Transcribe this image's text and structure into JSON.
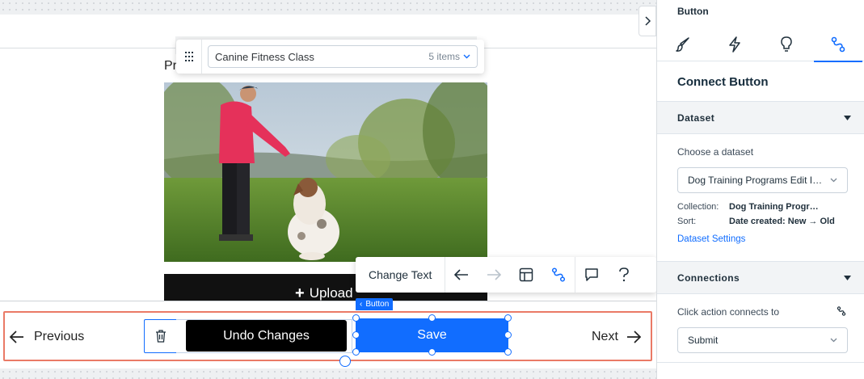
{
  "canvas": {
    "page_title_peek": "Pr",
    "dataset_toolbar": {
      "dataset_name": "Canine Fitness Class",
      "item_count": "5 items"
    },
    "upload_button_label": "Upload",
    "action_toolbar": {
      "change_text_label": "Change Text"
    },
    "element_tag": "Button",
    "nav_bar": {
      "previous_label": "Previous",
      "next_label": "Next",
      "undo_label": "Undo Changes",
      "save_label": "Save"
    }
  },
  "panel": {
    "title": "Button",
    "tabs": [
      "design-icon",
      "animation-icon",
      "help-bulb-icon",
      "connect-icon"
    ],
    "active_tab": 3,
    "heading": "Connect Button",
    "dataset_section": {
      "header": "Dataset",
      "choose_label": "Choose a dataset",
      "selected_dataset": "Dog Training Programs Edit I…",
      "collection_key": "Collection:",
      "collection_value": "Dog Training Progr…",
      "sort_key": "Sort:",
      "sort_value": "Date created: New → Old",
      "settings_link": "Dataset Settings"
    },
    "connections_section": {
      "header": "Connections",
      "click_action_label": "Click action connects to",
      "selected_action": "Submit"
    }
  },
  "colors": {
    "accent": "#116dff",
    "selection_outline": "#ea7a66",
    "dark_button": "#000000"
  }
}
